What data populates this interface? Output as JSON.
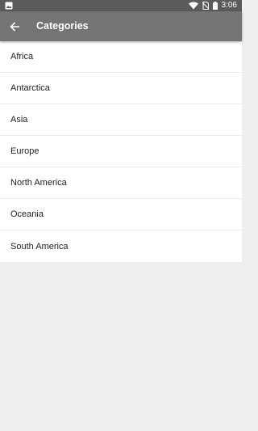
{
  "status_bar": {
    "time": "3:06",
    "icons": [
      "image-icon",
      "wifi-icon",
      "no-sim-icon",
      "battery-icon"
    ]
  },
  "app_bar": {
    "title": "Categories",
    "back_icon": "arrow-back-icon"
  },
  "categories": [
    {
      "label": "Africa"
    },
    {
      "label": "Antarctica"
    },
    {
      "label": "Asia"
    },
    {
      "label": "Europe"
    },
    {
      "label": "North America"
    },
    {
      "label": "Oceania"
    },
    {
      "label": "South America"
    }
  ],
  "colors": {
    "status_bar": "#5b5b5b",
    "app_bar": "#747474",
    "background": "#efefef",
    "list_background": "#ffffff",
    "text": "#212121"
  }
}
